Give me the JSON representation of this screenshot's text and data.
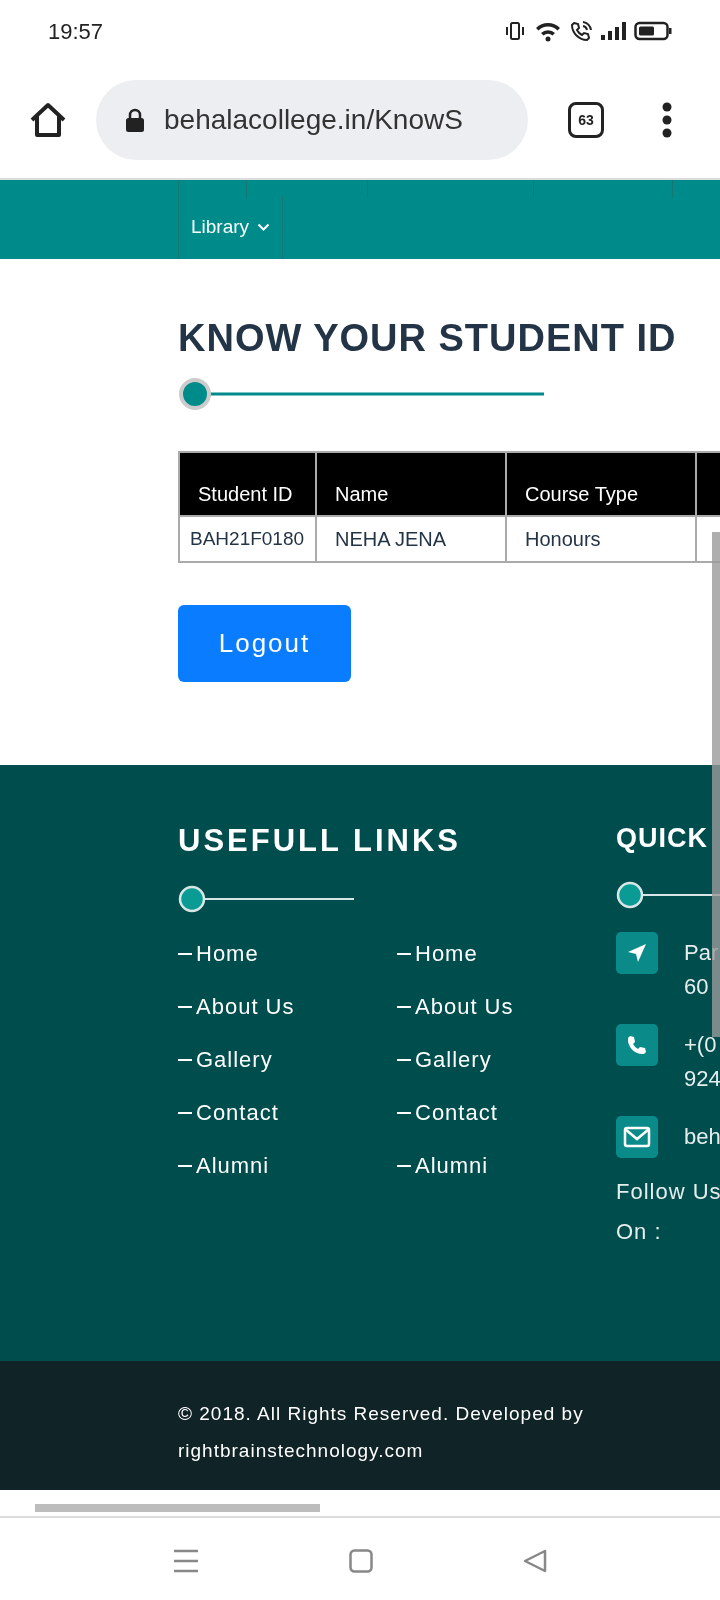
{
  "status_bar": {
    "time": "19:57"
  },
  "browser": {
    "url": "behalacollege.in/KnowS",
    "tab_count": "63"
  },
  "nav": {
    "items": [
      {
        "label": "Library",
        "dropdown": true
      }
    ]
  },
  "content": {
    "title": "KNOW YOUR STUDENT ID",
    "table": {
      "columns": [
        "Student ID",
        "Name",
        "Course Type"
      ],
      "rows": [
        [
          "BAH21F0180",
          "NEHA JENA",
          "Honours"
        ]
      ]
    },
    "logout_button": "Logout"
  },
  "footer": {
    "useful_links": {
      "title": "USEFULL LINKS",
      "columns": [
        [
          "Home",
          "About Us",
          "Gallery",
          "Contact",
          "Alumni"
        ],
        [
          "Home",
          "About Us",
          "Gallery",
          "Contact",
          "Alumni"
        ]
      ]
    },
    "quick_contact": {
      "title": "QUICK",
      "items": [
        {
          "kind": "location",
          "lines": [
            "Par",
            "60"
          ]
        },
        {
          "kind": "phone",
          "lines": [
            "+(0",
            "924"
          ]
        },
        {
          "kind": "email",
          "lines": [
            "beh"
          ]
        }
      ],
      "follow": [
        "Follow Us",
        "On :"
      ]
    }
  },
  "copyright": [
    "© 2018. All Rights Reserved. Developed by",
    "rightbrainstechnology.com"
  ]
}
